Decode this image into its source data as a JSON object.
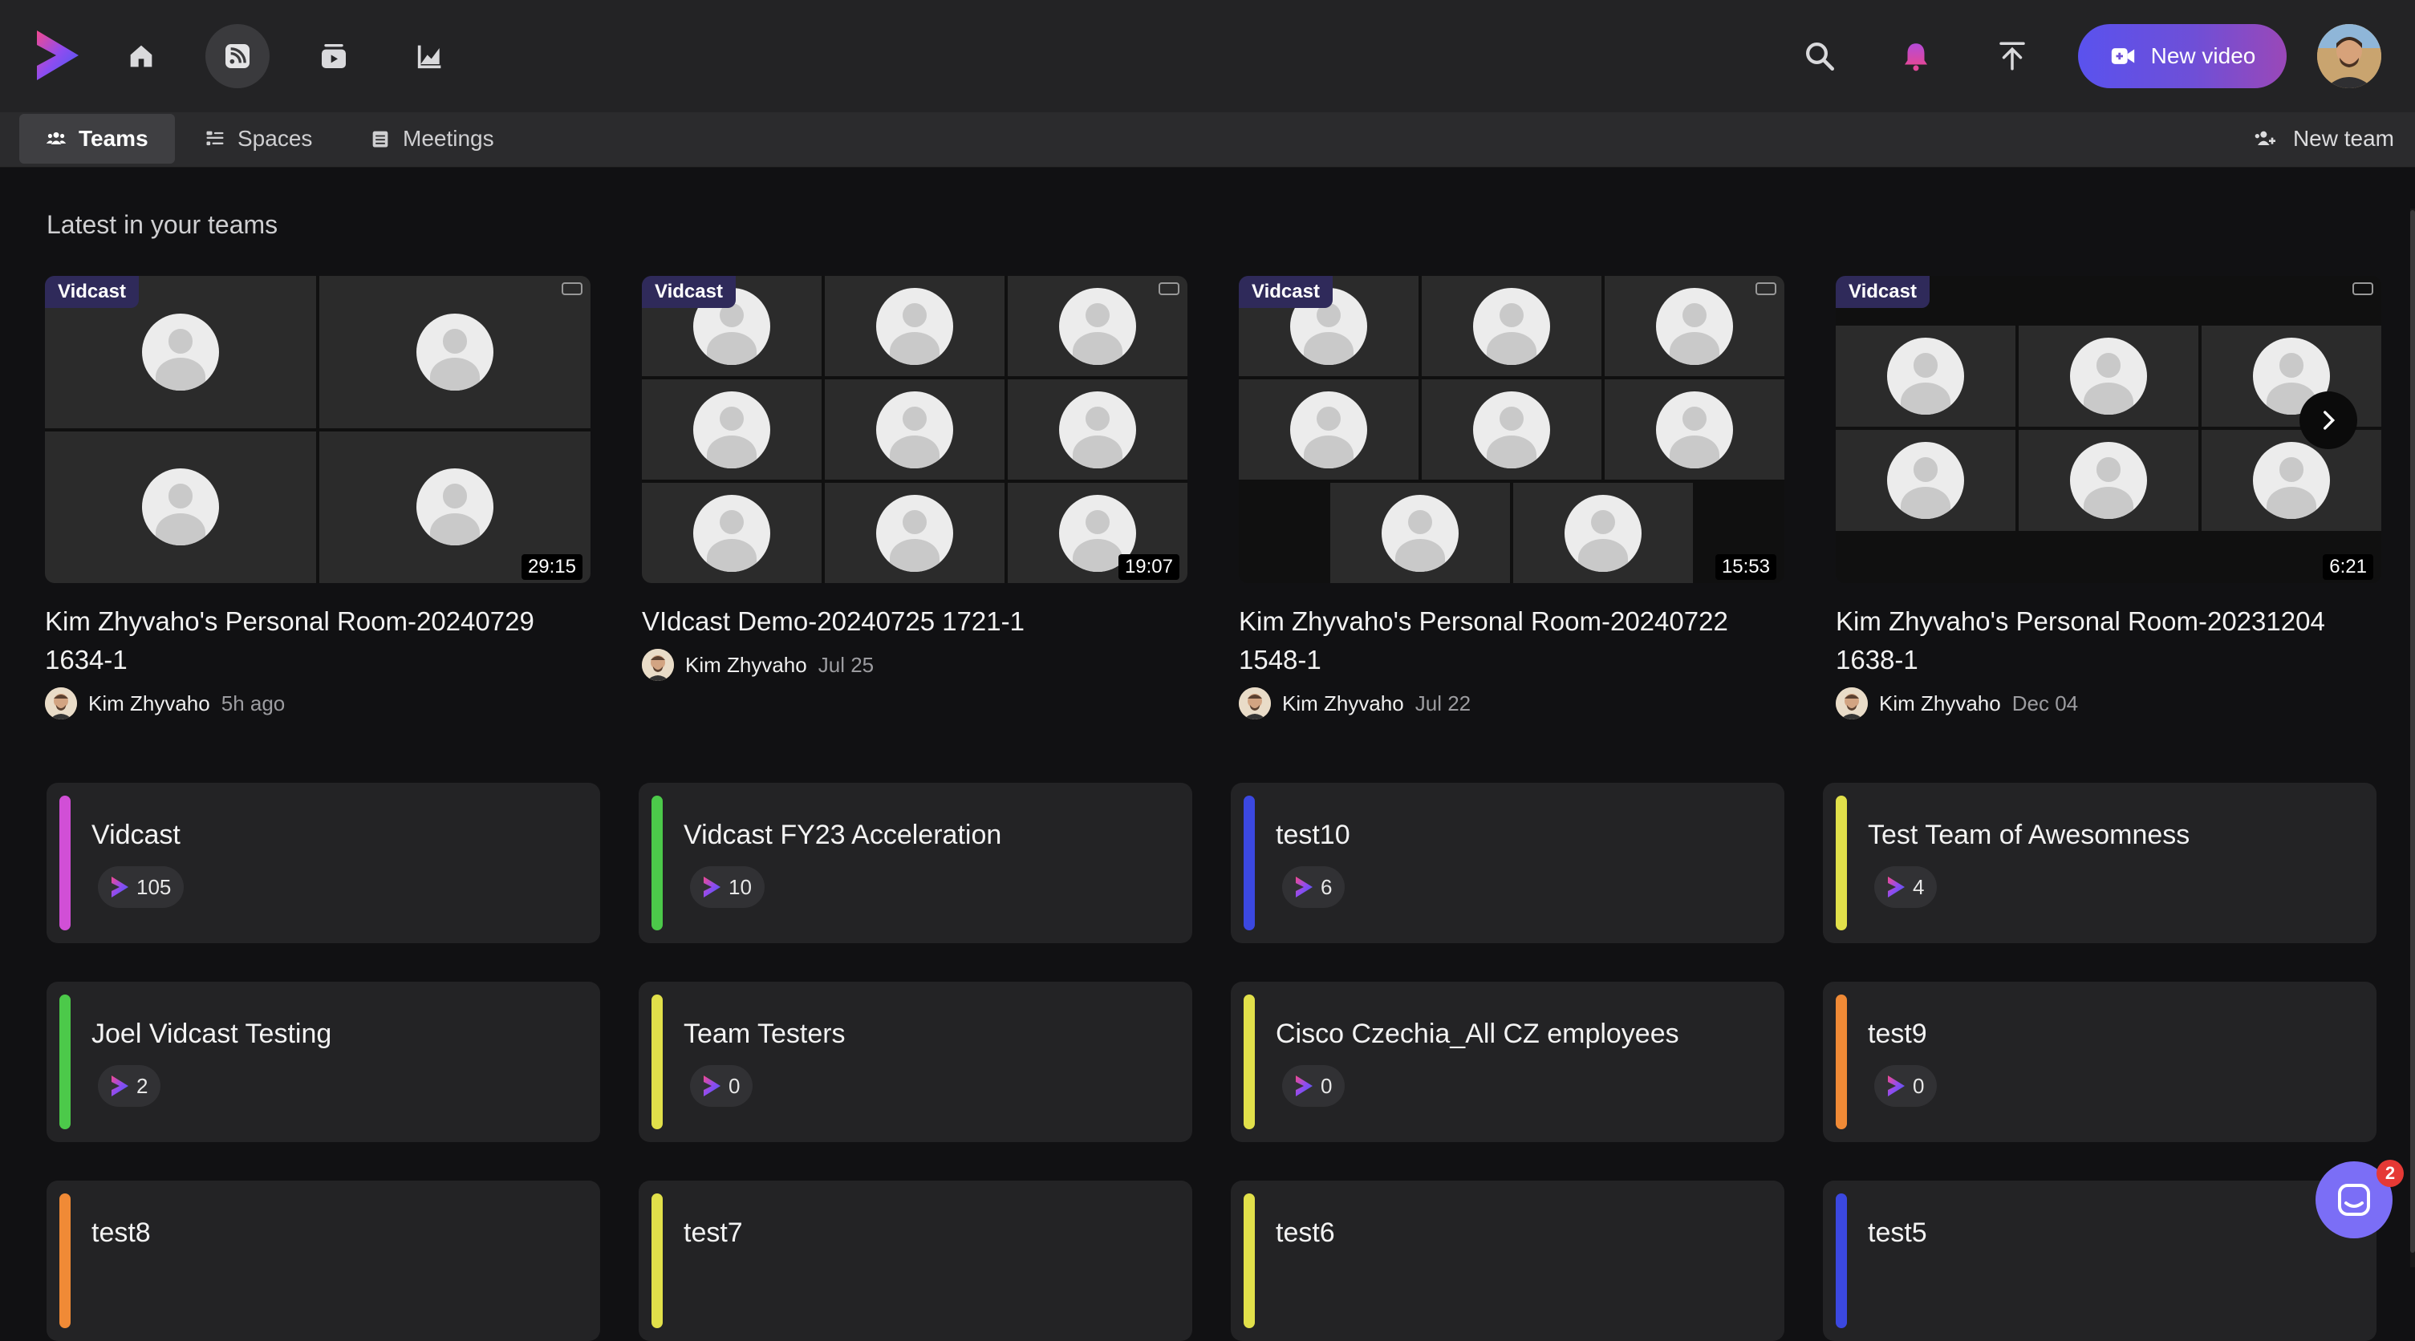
{
  "header": {
    "nav": [
      {
        "name": "home-icon"
      },
      {
        "name": "feed-icon",
        "active": true
      },
      {
        "name": "library-icon"
      },
      {
        "name": "analytics-icon"
      }
    ],
    "new_video_label": "New video",
    "accent_gradient": [
      "#5a52ee",
      "#9a48b8"
    ]
  },
  "tabs": {
    "items": [
      {
        "label": "Teams",
        "icon": "people-icon",
        "active": true
      },
      {
        "label": "Spaces",
        "icon": "spaces-icon"
      },
      {
        "label": "Meetings",
        "icon": "calendar-icon"
      }
    ],
    "new_team_label": "New team"
  },
  "main": {
    "section_title": "Latest in your teams",
    "videos": [
      {
        "badge": "Vidcast",
        "duration": "29:15",
        "title": "Kim Zhyvaho's Personal Room-20240729 1634-1",
        "author": "Kim Zhyvaho",
        "time": "5h ago"
      },
      {
        "badge": "Vidcast",
        "duration": "19:07",
        "title": "VIdcast Demo-20240725 1721-1",
        "author": "Kim Zhyvaho",
        "time": "Jul 25"
      },
      {
        "badge": "Vidcast",
        "duration": "15:53",
        "title": "Kim Zhyvaho's Personal Room-20240722 1548-1",
        "author": "Kim Zhyvaho",
        "time": "Jul 22"
      },
      {
        "badge": "Vidcast",
        "duration": "6:21",
        "title": "Kim Zhyvaho's Personal Room-20231204 1638-1",
        "author": "Kim Zhyvaho",
        "time": "Dec 04"
      }
    ],
    "teams": [
      {
        "name": "Vidcast",
        "count": "105",
        "color": "#d14fd6"
      },
      {
        "name": "Vidcast FY23 Acceleration",
        "count": "10",
        "color": "#4cc94a"
      },
      {
        "name": "test10",
        "count": "6",
        "color": "#3b48e0"
      },
      {
        "name": "Test Team of Awesomness",
        "count": "4",
        "color": "#e1e04a"
      },
      {
        "name": "Joel Vidcast Testing",
        "count": "2",
        "color": "#4cc94a"
      },
      {
        "name": "Team Testers",
        "count": "0",
        "color": "#e1e04a"
      },
      {
        "name": "Cisco Czechia_All CZ employees",
        "count": "0",
        "color": "#e1e04a"
      },
      {
        "name": "test9",
        "count": "0",
        "color": "#f08a36"
      },
      {
        "name": "test8",
        "count": "",
        "color": "#f08a36"
      },
      {
        "name": "test7",
        "count": "",
        "color": "#e1e04a"
      },
      {
        "name": "test6",
        "count": "",
        "color": "#e1e04a"
      },
      {
        "name": "test5",
        "count": "",
        "color": "#3b48e0"
      }
    ]
  },
  "chat": {
    "badge_count": "2"
  }
}
